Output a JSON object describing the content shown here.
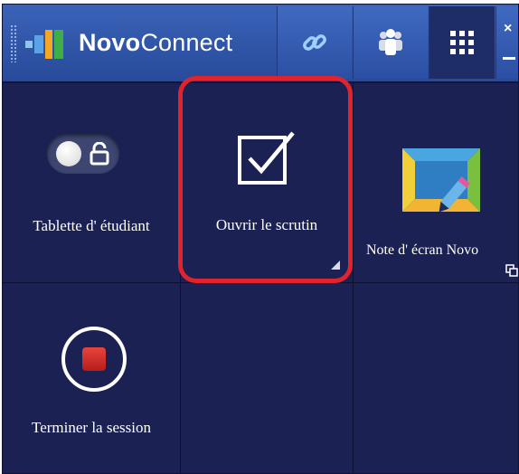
{
  "window": {
    "title_bold": "Novo",
    "title_regular": "Connect",
    "close_glyph": "×",
    "icons": [
      "link-icon",
      "users-icon",
      "grid-icon",
      "close-icon",
      "minimize-icon"
    ]
  },
  "tiles": {
    "student": {
      "label": "Tablette d' étudiant",
      "icon": "toggle-lock-icon"
    },
    "poll": {
      "label": "Ouvrir le scrutin",
      "icon": "checkbox-icon"
    },
    "note": {
      "label": "Note d' écran Novo",
      "icon": "screen-note-icon"
    },
    "end": {
      "label": "Terminer la session",
      "icon": "stop-icon"
    }
  },
  "colors": {
    "background": "#1b2152",
    "topbar": "#2f56a8",
    "highlight": "#e0232c",
    "stop": "#d02a24"
  }
}
